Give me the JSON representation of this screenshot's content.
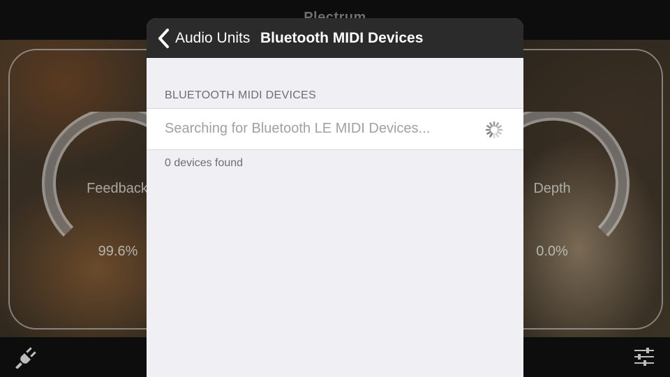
{
  "app": {
    "title": "Plectrum"
  },
  "knobs": {
    "left": {
      "label": "Feedback",
      "value": "99.6%"
    },
    "right": {
      "label": "Depth",
      "value": "0.0%"
    }
  },
  "modal": {
    "back_label": "Audio Units",
    "title": "Bluetooth MIDI Devices",
    "section_header": "BLUETOOTH MIDI DEVICES",
    "searching_text": "Searching for Bluetooth LE MIDI Devices...",
    "footer": "0 devices found"
  },
  "icons": {
    "bottom_left": "plug-icon",
    "bottom_right": "mixer-sliders-icon",
    "back": "chevron-left-icon",
    "spinner": "activity-spinner-icon"
  },
  "colors": {
    "modal_nav": "#2b2b2b",
    "modal_bg": "#efeff4",
    "bar_bg": "#0d0d0d"
  }
}
